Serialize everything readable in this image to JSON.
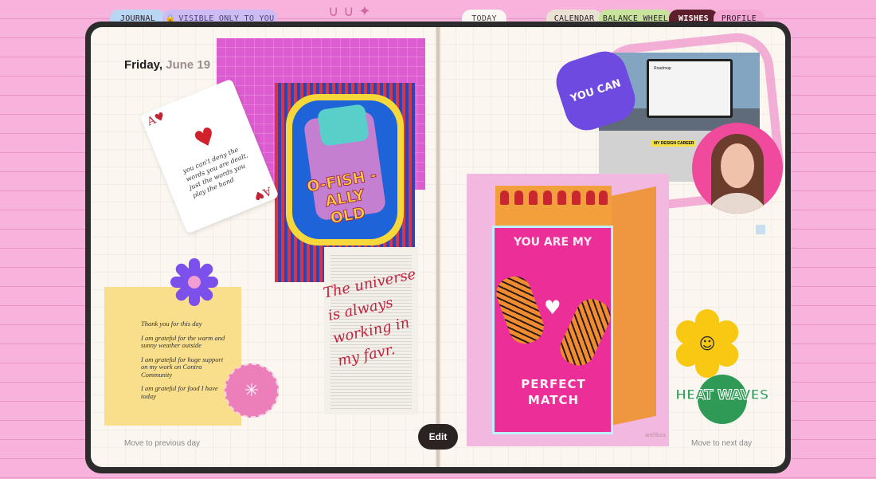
{
  "tabs": {
    "journal": "JOURNAL",
    "visible_only": "VISIBLE ONLY TO YOU",
    "today": "TODAY",
    "calendar": "CALENDAR",
    "balance_wheel": "BALANCE WHEEL",
    "wishes": "WISHES",
    "profile": "PROFILE"
  },
  "icons": {
    "lock": "lock-icon"
  },
  "left_page": {
    "date_day": "Friday,",
    "date_rest": "June 19",
    "prev_link": "Move to previous day",
    "quote": "The universe is always working in my favr.",
    "ace_card_text": "you can't deny the words you are dealt, just the words you play the hand",
    "fish_card_text": "O-FISH -ALLY OLD",
    "sticker_text": "CHEMICAL THINGS",
    "gratitude_notes": [
      "Thank you for this day",
      "I am grateful for the warm and sunny weather outside",
      "I am grateful for huge support on my work on Contra Community",
      "I am grateful for food I have today"
    ]
  },
  "right_page": {
    "next_link": "Move to next day",
    "roadmap_label": "Roadmap",
    "photo_tag": "MY DESIGN CAREER",
    "you_can_sticker": "YOU CAN",
    "matchbox_top": "YOU ARE MY",
    "matchbox_bottom": "PERFECT MATCH",
    "matchbox_signature": "wellbos",
    "heatwaves": "HEAT WAVES"
  },
  "actions": {
    "edit": "Edit"
  },
  "colors": {
    "background": "#f7b3dc",
    "book_cover": "#2c2c2c",
    "page": "#fbf6ef",
    "wishes_tab": "#5c1f2b"
  }
}
